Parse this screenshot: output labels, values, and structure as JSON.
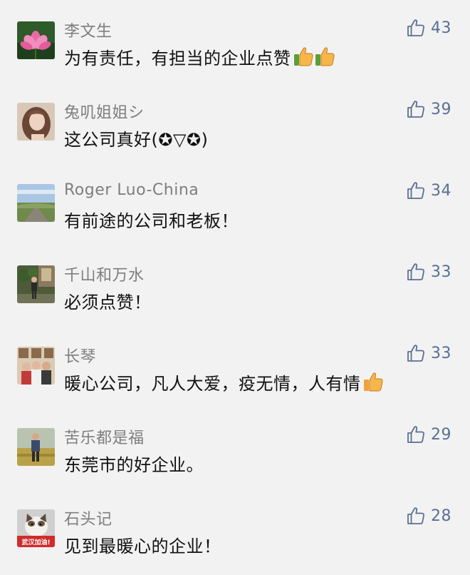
{
  "comments": [
    {
      "user": "李文生",
      "text": "为有责任，有担当的企业点赞",
      "emoji": "👍👍",
      "likes": "43",
      "avatar": "lotus"
    },
    {
      "user": "兔叽姐姐シ",
      "text": "这公司真好(✪▽✪)",
      "emoji": "",
      "likes": "39",
      "avatar": "woman"
    },
    {
      "user": "Roger Luo-China",
      "text": "有前途的公司和老板！",
      "emoji": "",
      "likes": "34",
      "avatar": "landscape"
    },
    {
      "user": "千山和万水",
      "text": "必须点赞！",
      "emoji": "",
      "likes": "33",
      "avatar": "person-garden"
    },
    {
      "user": "长琴",
      "text": "暖心公司，凡人大爱，疫无情，人有情",
      "emoji": "👍",
      "likes": "33",
      "avatar": "family"
    },
    {
      "user": "苦乐都是福",
      "text": "东莞市的好企业。",
      "emoji": "",
      "likes": "29",
      "avatar": "man-field"
    },
    {
      "user": "石头记",
      "text": "见到最暖心的企业！",
      "emoji": "",
      "likes": "28",
      "avatar": "cat-wuhan",
      "avatar_text": "武汉加油!"
    }
  ],
  "colors": {
    "username": "#7e7e7e",
    "text": "#111111",
    "like": "#5a6f96",
    "background": "#f2f2f2"
  },
  "icons": {
    "like": "thumbs-up-outline-icon",
    "emoji": "thumbs-up-emoji-icon"
  }
}
